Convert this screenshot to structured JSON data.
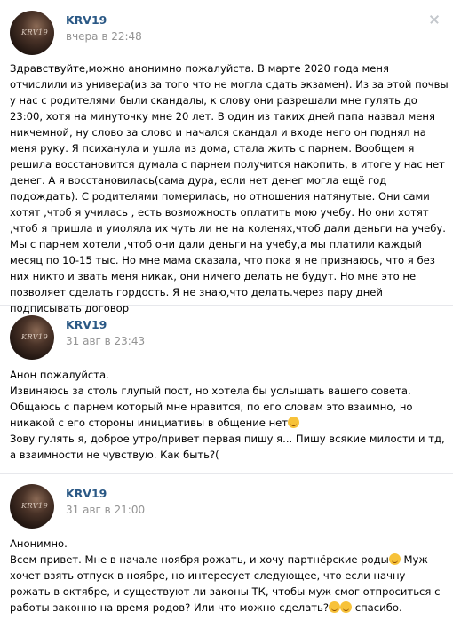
{
  "posts": [
    {
      "author": "KRV19",
      "date": "вчера в 22:48",
      "avatar_text": "KRV19",
      "text": "Здравствуйте,можно анонимно пожалуйста. В марте 2020 года меня отчислили из универа(из за того что не могла сдать экзамен). Из за этой почвы у нас с родителями были скандалы, к слову они разрешали мне гулять до 23:00, хотя на минуточку мне 20 лет. В один из таких дней папа назвал меня никчемной, ну слово за слово и начался скандал и входе него он поднял на меня руку. Я психанула и ушла из дома, стала жить с парнем. Вообщем я решила восстановится думала с парнем получится накопить, в итоге у нас нет денег. А я восстановилась(сама дура, если нет денег могла ещё год подождать). С родителями померилась, но отношения натянутые. Они сами хотят ,чтоб я училась , есть возможность оплатить мою учебу. Но они хотят ,чтоб я пришла и умоляла их чуть ли не на коленях,чтоб дали деньги на учебу. Мы с парнем хотели ,чтоб они дали деньги на учебу,а мы платили каждый месяц по 10-15 тыс. Но мне мама сказала, что пока я не признаюсь, что я без них никто и звать меня никак, они ничего делать не будут. Но мне это не позволяет сделать гордость. Я не знаю,что делать.через пару дней подписывать договор"
    },
    {
      "author": "KRV19",
      "date": "31 авг в 23:43",
      "avatar_text": "KRV19",
      "lines": [
        "Анон пожалуйста.",
        "Извиняюсь за столь глупый пост, но хотела бы услышать вашего совета.",
        "Общаюсь с парнем который мне нравится, по его словам это взаимно, но никакой с его стороны инициативы в общение нет",
        "Зову гулять я, доброе утро/привет первая пишу я... Пишу всякие милости и тд, а взаимности не чувствую. Как быть?("
      ]
    },
    {
      "author": "KRV19",
      "date": "31 авг в 21:00",
      "avatar_text": "KRV19",
      "lines": [
        "Анонимно.",
        "Всем привет. Мне в начале ноября рожать, и хочу партнёрские роды",
        " Муж хочет взять отпуск в ноябре, но интересует следующее, что если начну рожать в октябре, и существуют ли законы ТК, чтобы муж смог отпроситься с работы законно на время родов? Или что можно сделать?",
        " спасибо."
      ]
    }
  ],
  "colors": {
    "author": "#2a5885",
    "date": "#939393",
    "separator": "#e7e8ec"
  },
  "icons": {
    "menu": "close-icon",
    "emoji": "smiling-face-emoji-icon"
  }
}
